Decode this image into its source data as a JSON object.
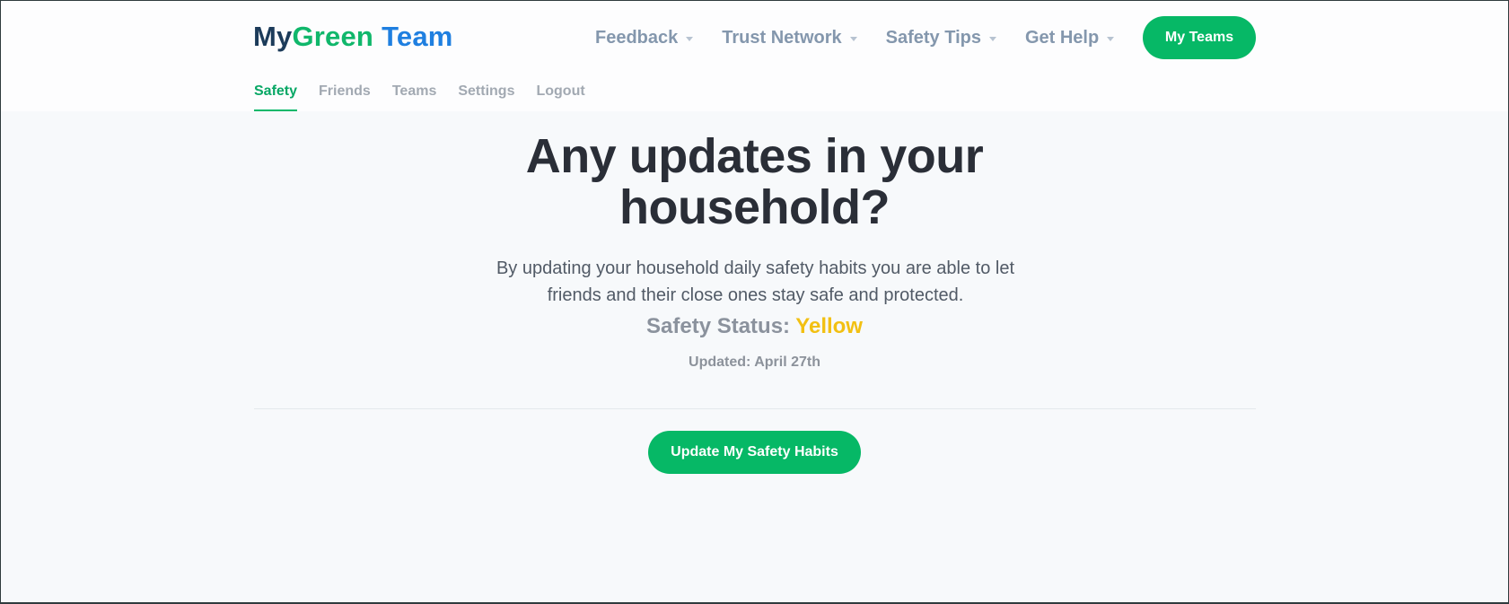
{
  "logo": {
    "part_my": "My",
    "part_green": "Green",
    "part_team": "Team"
  },
  "top_nav": {
    "items": [
      {
        "label": "Feedback",
        "icon": "chevron-down-icon"
      },
      {
        "label": "Trust Network",
        "icon": "chevron-down-icon"
      },
      {
        "label": "Safety Tips",
        "icon": "chevron-down-icon"
      },
      {
        "label": "Get Help",
        "icon": "chevron-down-icon"
      }
    ],
    "my_teams_label": "My Teams"
  },
  "sub_nav": {
    "items": [
      {
        "label": "Safety",
        "active": true
      },
      {
        "label": "Friends",
        "active": false
      },
      {
        "label": "Teams",
        "active": false
      },
      {
        "label": "Settings",
        "active": false
      },
      {
        "label": "Logout",
        "active": false
      }
    ]
  },
  "main": {
    "headline_line1": "Any updates in your",
    "headline_line2": "household?",
    "description_line1": "By updating your household daily safety habits you are able to let",
    "description_line2": "friends and their close ones stay safe and protected.",
    "status_label": "Safety Status:",
    "status_value": "Yellow",
    "updated_text": "Updated: April 27th",
    "update_button_label": "Update My Safety Habits"
  },
  "colors": {
    "brand_green": "#06b866",
    "brand_blue": "#1f7fe0",
    "brand_navy": "#1c3b5a",
    "status_yellow": "#f2c012",
    "nav_text": "#8497ad",
    "headline": "#2a2e37"
  }
}
